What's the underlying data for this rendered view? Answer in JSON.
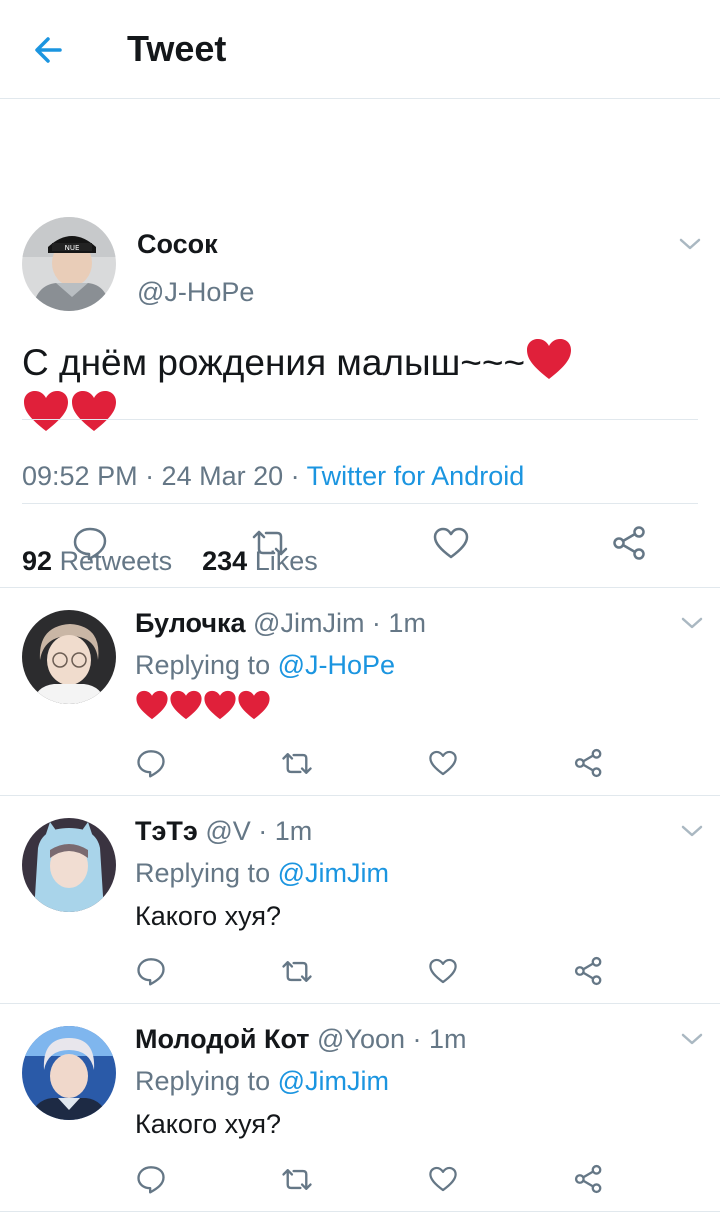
{
  "header": {
    "title": "Tweet"
  },
  "main_tweet": {
    "name": "Сосок",
    "handle": "@J-HoPe",
    "text": "С днём рождения малыш~~~",
    "hearts_line1": 1,
    "hearts_line2": 2,
    "time": "09:52 PM · 24 Mar 20 · ",
    "source": "Twitter for Android",
    "retweets_count": "92",
    "retweets_label": "Retweets",
    "likes_count": "234",
    "likes_label": "Likes"
  },
  "replies": [
    {
      "name": "Булочка",
      "meta": "@JimJim · 1m",
      "replying_prefix": "Replying to ",
      "replying_to": "@J-HoPe",
      "text": "",
      "hearts": 4
    },
    {
      "name": "ТэТэ",
      "meta": "@V · 1m",
      "replying_prefix": "Replying to ",
      "replying_to": "@JimJim",
      "text": "Какого хуя?"
    },
    {
      "name": "Молодой Кот",
      "meta": "@Yoon · 1m",
      "replying_prefix": "Replying to ",
      "replying_to": "@JimJim",
      "text": "Какого хуя?"
    }
  ],
  "colors": {
    "accent": "#1b95e0",
    "secondary_text": "#657786",
    "border": "#e1e8ed",
    "heart": "#e0245e"
  },
  "icons": [
    "back-arrow-icon",
    "chevron-down-icon",
    "reply-icon",
    "retweet-icon",
    "like-icon",
    "share-icon",
    "red-heart-emoji"
  ]
}
